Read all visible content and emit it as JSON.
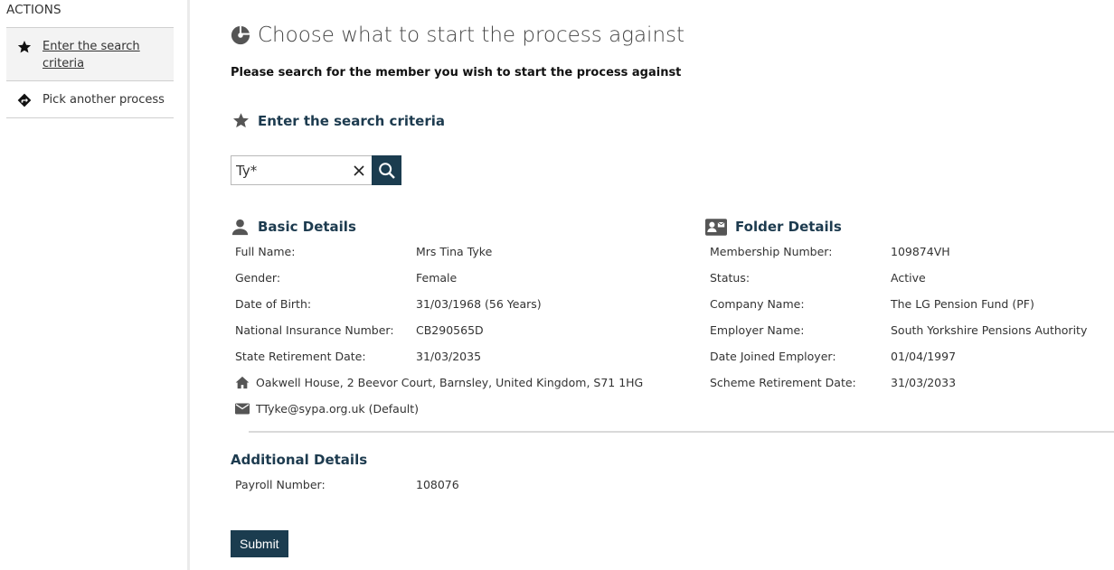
{
  "sidebar": {
    "title": "ACTIONS",
    "items": [
      {
        "label": "Enter the search criteria",
        "icon": "star-icon",
        "active": true
      },
      {
        "label": "Pick another process",
        "icon": "signpost-icon",
        "active": false
      }
    ]
  },
  "page": {
    "title": "Choose what to start the process against",
    "title_icon": "process-icon",
    "subtitle": "Please search for the member you wish to start the process against"
  },
  "search": {
    "heading": "Enter the search criteria",
    "value": "Ty*",
    "clear_icon": "close-icon",
    "search_icon": "search-icon"
  },
  "basic_details": {
    "heading": "Basic Details",
    "rows": [
      {
        "label": "Full Name:",
        "value": "Mrs Tina Tyke"
      },
      {
        "label": "Gender:",
        "value": "Female"
      },
      {
        "label": "Date of Birth:",
        "value": "31/03/1968 (56 Years)"
      },
      {
        "label": "National Insurance Number:",
        "value": "CB290565D"
      },
      {
        "label": "State Retirement Date:",
        "value": "31/03/2035"
      }
    ],
    "address": "Oakwell House, 2 Beevor Court, Barnsley, United Kingdom, S71 1HG",
    "email": "TTyke@sypa.org.uk (Default)"
  },
  "folder_details": {
    "heading": "Folder Details",
    "rows": [
      {
        "label": "Membership Number:",
        "value": "109874VH"
      },
      {
        "label": "Status:",
        "value": "Active"
      },
      {
        "label": "Company Name:",
        "value": "The LG Pension Fund (PF)"
      },
      {
        "label": "Employer Name:",
        "value": "South Yorkshire Pensions Authority"
      },
      {
        "label": "Date Joined Employer:",
        "value": "01/04/1997"
      },
      {
        "label": "Scheme Retirement Date:",
        "value": "31/03/2033"
      }
    ]
  },
  "additional_details": {
    "heading": "Additional Details",
    "rows": [
      {
        "label": "Payroll Number:",
        "value": "108076"
      }
    ]
  },
  "submit_label": "Submit",
  "colors": {
    "accent": "#1b3c4f",
    "heading": "#1d3b4f",
    "active_bg": "#f3f3f3"
  }
}
